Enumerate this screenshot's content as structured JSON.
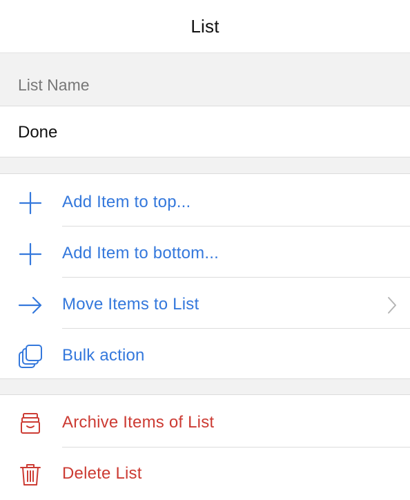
{
  "header": {
    "title": "List"
  },
  "list_name": {
    "label": "List Name",
    "value": "Done"
  },
  "actions": [
    {
      "label": "Add Item to top...",
      "icon": "plus-icon"
    },
    {
      "label": "Add Item to bottom...",
      "icon": "plus-icon"
    },
    {
      "label": "Move Items to List",
      "icon": "arrow-right-icon"
    },
    {
      "label": "Bulk action",
      "icon": "stack-icon"
    }
  ],
  "danger_actions": [
    {
      "label": "Archive Items of List",
      "icon": "archive-box-icon"
    },
    {
      "label": "Delete List",
      "icon": "trash-icon"
    }
  ],
  "colors": {
    "accent": "#3478dc",
    "destructive": "#cc3b33",
    "background": "#f2f2f2"
  }
}
